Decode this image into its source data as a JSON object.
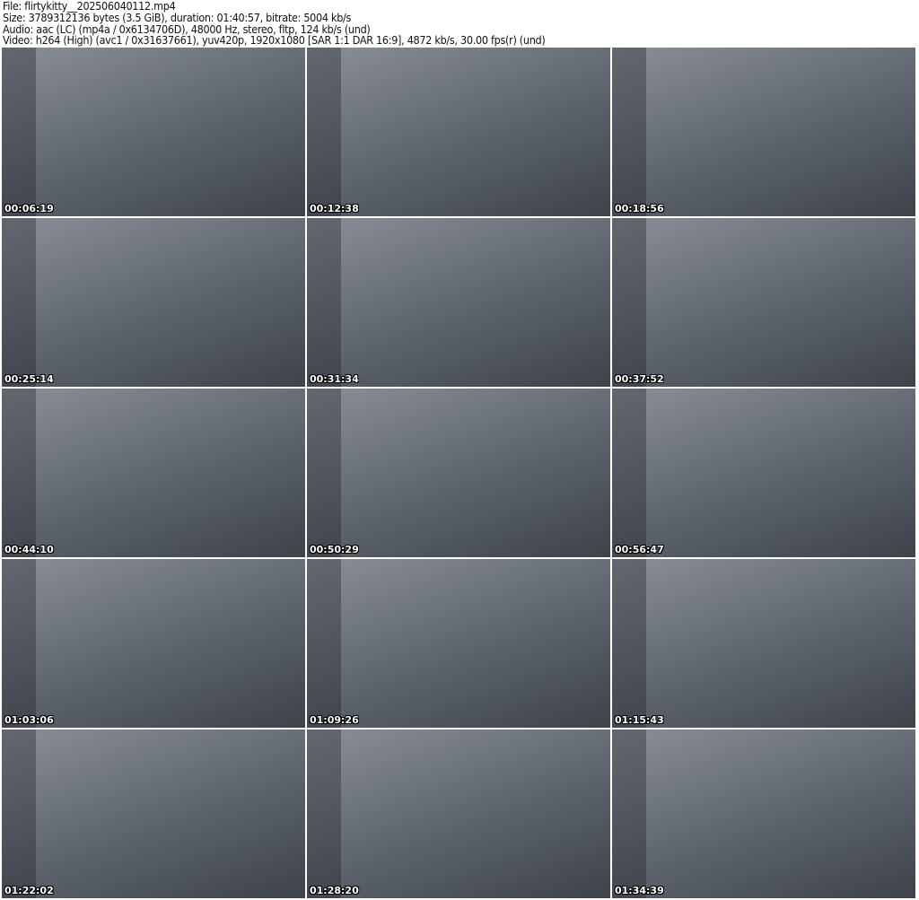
{
  "header": {
    "file": "File: flirtykitty__202506040112.mp4",
    "size": "Size: 3789312136 bytes (3.5 GiB), duration: 01:40:57, bitrate: 5004 kb/s",
    "audio": "Audio: aac (LC) (mp4a / 0x6134706D), 48000 Hz, stereo, fltp, 124 kb/s (und)",
    "video": "Video: h264 (High) (avc1 / 0x31637661), yuv420p, 1920x1080 [SAR 1:1 DAR 16:9], 4872 kb/s, 30.00 fps(r) (und)"
  },
  "thumbnails": [
    {
      "timestamp": "00:06:19"
    },
    {
      "timestamp": "00:12:38"
    },
    {
      "timestamp": "00:18:56"
    },
    {
      "timestamp": "00:25:14"
    },
    {
      "timestamp": "00:31:34"
    },
    {
      "timestamp": "00:37:52"
    },
    {
      "timestamp": "00:44:10"
    },
    {
      "timestamp": "00:50:29"
    },
    {
      "timestamp": "00:56:47"
    },
    {
      "timestamp": "01:03:06"
    },
    {
      "timestamp": "01:09:26"
    },
    {
      "timestamp": "01:15:43"
    },
    {
      "timestamp": "01:22:02"
    },
    {
      "timestamp": "01:28:20"
    },
    {
      "timestamp": "01:34:39"
    }
  ]
}
